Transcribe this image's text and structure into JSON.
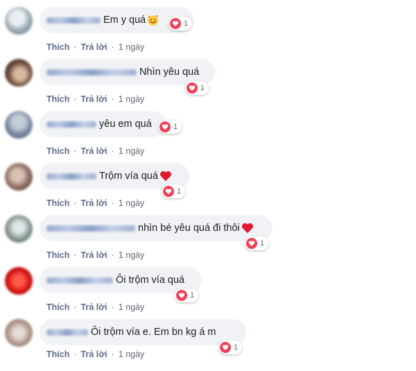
{
  "colors": {
    "bubble_bg": "#f0f2f5",
    "heart_reaction": "#f33e58",
    "action_link": "#5c6a8a",
    "text": "#1c1e21"
  },
  "comments": [
    {
      "text": "Em y quá",
      "emoji": "smiling-face-with-hearts-icon",
      "reaction_count": "1",
      "like": "Thích",
      "reply": "Trả lời",
      "separator": "·",
      "time": "1 ngày"
    },
    {
      "text": "Nhìn yêu quá",
      "emoji": "",
      "reaction_count": "1",
      "like": "Thích",
      "reply": "Trả lời",
      "separator": "·",
      "time": "1 ngày"
    },
    {
      "text": "yêu em quá",
      "emoji": "",
      "reaction_count": "1",
      "like": "Thích",
      "reply": "Trả lời",
      "separator": "·",
      "time": "1 ngày"
    },
    {
      "text": "Trộm vía quá",
      "emoji": "red-heart-icon",
      "reaction_count": "1",
      "like": "Thích",
      "reply": "Trả lời",
      "separator": "·",
      "time": "1 ngày"
    },
    {
      "text": "nhìn bé yêu quá đi thôi",
      "emoji": "red-heart-icon",
      "reaction_count": "1",
      "like": "Thích",
      "reply": "Trả lời",
      "separator": "·",
      "time": "1 ngày"
    },
    {
      "text": "Ôi trộm vía quá",
      "emoji": "",
      "reaction_count": "1",
      "like": "Thích",
      "reply": "Trả lời",
      "separator": "·",
      "time": "1 ngày"
    },
    {
      "text": "Ôi trộm vía e. Em bn kg á m",
      "emoji": "",
      "reaction_count": "1",
      "like": "Thích",
      "reply": "Trả lời",
      "separator": "·",
      "time": "1 ngày"
    }
  ]
}
